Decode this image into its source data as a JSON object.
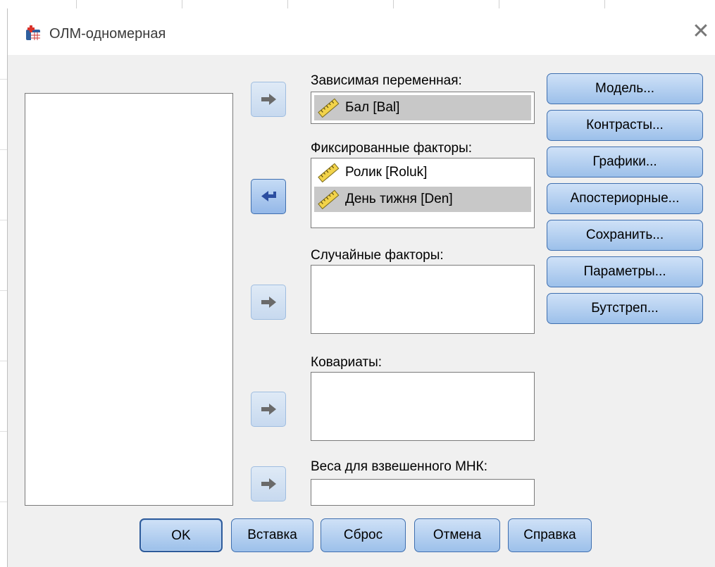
{
  "window": {
    "title": "ОЛМ-одномерная"
  },
  "labels": {
    "dependent": "Зависимая переменная:",
    "fixed": "Фиксированные факторы:",
    "random": "Случайные факторы:",
    "covariates": "Ковариаты:",
    "weights": "Веса для взвешенного МНК:"
  },
  "dependent_variable": {
    "name": "Бал [Bal]",
    "icon": "scale-ruler-icon",
    "selected": true
  },
  "fixed_factors": [
    {
      "name": "Ролик [Roluk]",
      "icon": "scale-ruler-icon",
      "selected": false
    },
    {
      "name": "День тижня [Den]",
      "icon": "scale-ruler-icon",
      "selected": true
    }
  ],
  "side_buttons": [
    {
      "label": "Модель...",
      "name": "model-button"
    },
    {
      "label": "Контрасты...",
      "name": "contrasts-button"
    },
    {
      "label": "Графики...",
      "name": "plots-button"
    },
    {
      "label": "Апостериорные...",
      "name": "posthoc-button"
    },
    {
      "label": "Сохранить...",
      "name": "save-button"
    },
    {
      "label": "Параметры...",
      "name": "options-button"
    },
    {
      "label": "Бутстреп...",
      "name": "bootstrap-button"
    }
  ],
  "bottom_buttons": {
    "ok": "OK",
    "paste": "Вставка",
    "reset": "Сброс",
    "cancel": "Отмена",
    "help": "Справка"
  },
  "colors": {
    "button_fill": "#b4cfee",
    "button_border": "#3f6faf",
    "selection": "#c8c8c8"
  }
}
